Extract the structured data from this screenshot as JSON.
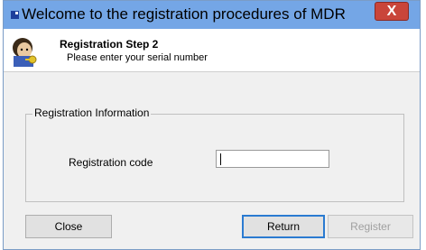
{
  "window": {
    "title": "Welcome to the registration procedures of MDR",
    "close_glyph": "X",
    "icons": {
      "app": "app-icon",
      "close": "close-icon",
      "wizard": "user-key-icon"
    }
  },
  "header": {
    "step_title": "Registration Step 2",
    "step_subtitle": "Please enter your serial number"
  },
  "group": {
    "label": "Registration Information",
    "field_label": "Registration code",
    "field_value": "",
    "field_placeholder": ""
  },
  "buttons": {
    "close": "Close",
    "return": "Return",
    "register": "Register"
  },
  "colors": {
    "titlebar": "#74a6e6",
    "close_button": "#c9453a",
    "return_focus": "#2b7bd1"
  }
}
